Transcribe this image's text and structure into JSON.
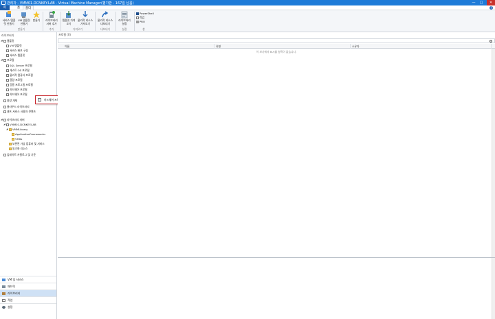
{
  "window": {
    "title": "관리자 - VMM01.DCNKEY.LAB - Virtual Machine Manager(평가판 - 167일 남음)",
    "controls": [
      "—",
      "□",
      "✕"
    ]
  },
  "ribbon_tabs": {
    "file": "파일",
    "home": "홈",
    "folder": "폴더"
  },
  "ribbon": {
    "buttons": [
      {
        "label": "서비스 템플릿 만들기"
      },
      {
        "label": "VM 템플릿 만들기"
      },
      {
        "label": "만들기"
      },
      {
        "label": "라이브러리 서버 추가"
      },
      {
        "label": "템플릿 가져오기"
      },
      {
        "label": "물리적 리소스 가져오기"
      },
      {
        "label": "물리적 리소스 내보내기"
      },
      {
        "label": "라이브러리 설정"
      }
    ],
    "groups": [
      "만들기",
      "추가",
      "가져오기",
      "내보내기",
      "설정",
      "창"
    ],
    "window_items": [
      "PowerShell",
      "작업",
      "PRO"
    ]
  },
  "left_panel": {
    "header": "라이브러리",
    "tree": [
      {
        "label": "템플릿",
        "level": 0,
        "expanded": true
      },
      {
        "label": "VM 템플릿",
        "level": 1
      },
      {
        "label": "서비스 배포 구성",
        "level": 1
      },
      {
        "label": "서비스 템플릿",
        "level": 1
      },
      {
        "label": "프로필",
        "level": 0,
        "expanded": true
      },
      {
        "label": "SQL Server 프로필",
        "level": 1
      },
      {
        "label": "게스트 OS 프로필",
        "level": 1
      },
      {
        "label": "물리적 컴퓨터 프로필",
        "level": 1
      },
      {
        "label": "용량 프로필",
        "level": 1
      },
      {
        "label": "응용 프로그램 프로필",
        "level": 1
      },
      {
        "label": "하드웨어 프로필",
        "level": 1
      },
      {
        "label": "하드웨어 프로필",
        "level": 1
      },
      {
        "label": "용량 개체",
        "level": 0
      },
      {
        "label": "클라우드 라이브러리",
        "level": 0
      },
      {
        "label": "셀프 서비스 사용자 콘텐츠",
        "level": 0
      },
      {
        "label": "라이브러리 서버",
        "level": 0,
        "expanded": true
      },
      {
        "label": "VMM01.DCNKEY.LAB",
        "level": 1,
        "expanded": true
      },
      {
        "label": "VMMLibrary",
        "level": 2,
        "expanded": true
      },
      {
        "label": "ApplicationFrameworks",
        "level": 3
      },
      {
        "label": "VHDs",
        "level": 3
      },
      {
        "label": "보관된 가상 컴퓨터 및 서비스",
        "level": 2
      },
      {
        "label": "동기화 리소스",
        "level": 2
      },
      {
        "label": "업데이트 카탈로그 및 기준",
        "level": 0
      }
    ],
    "context_menu": {
      "label": "하드웨어 프로필 만들기"
    }
  },
  "workspaces": [
    {
      "label": "VM 및 서비스",
      "active": false
    },
    {
      "label": "패브릭",
      "active": false
    },
    {
      "label": "라이브러리",
      "active": true
    },
    {
      "label": "작업",
      "active": false
    },
    {
      "label": "설정",
      "active": false
    }
  ],
  "main": {
    "header": "프로필 (0)",
    "columns": [
      "이름",
      "유형",
      "소유자"
    ],
    "empty_message": "이 보기에서 표시할 항목이 없습니다."
  },
  "colors": {
    "titlebar": "#1e7bd8",
    "file_tab": "#1e5fad",
    "context_border": "#c8262c",
    "active_workspace": "#cfe1f5"
  }
}
